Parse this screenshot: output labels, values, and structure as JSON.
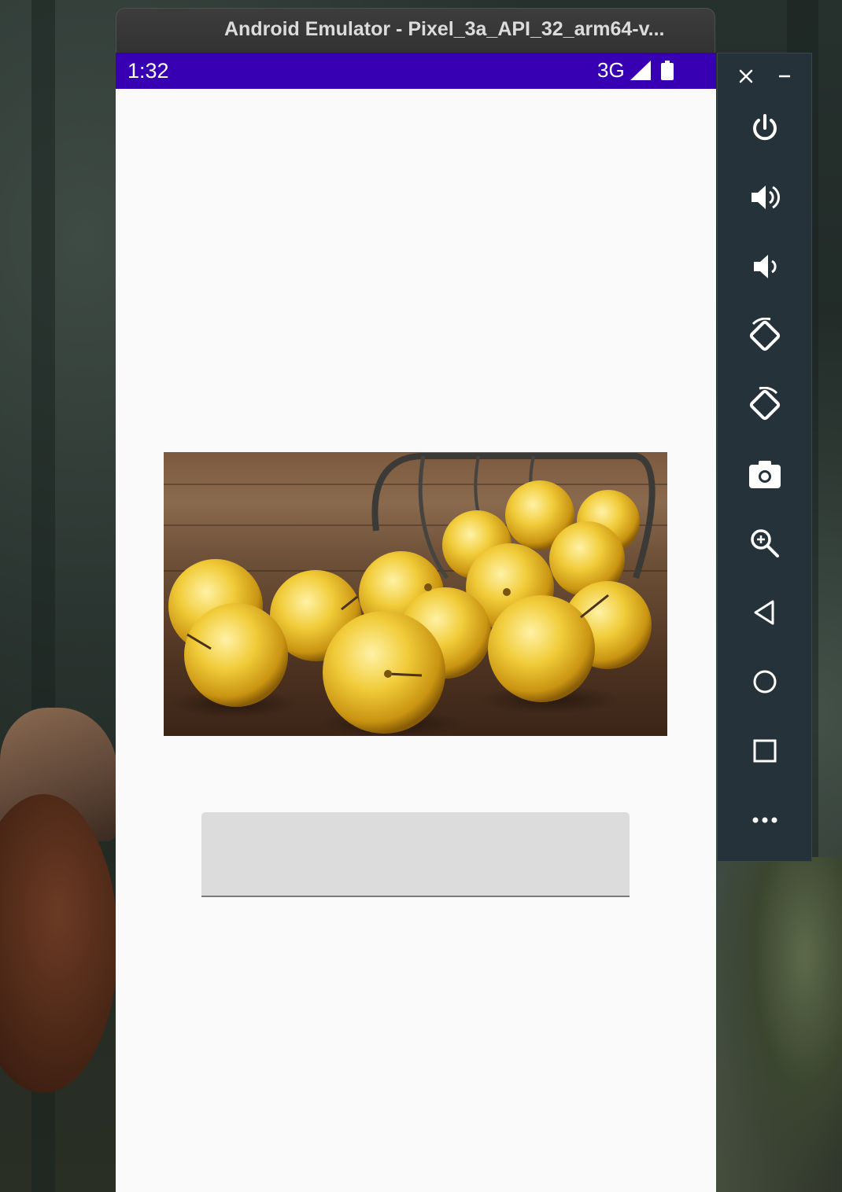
{
  "window": {
    "title": "Android Emulator - Pixel_3a_API_32_arm64-v..."
  },
  "status_bar": {
    "time": "1:32",
    "network": "3G",
    "signal_icon": "signal-icon",
    "battery_icon": "battery-icon",
    "color": "#3700b3"
  },
  "content": {
    "image_description_icon": "yellow-apples-photo",
    "text_field": {
      "value": "",
      "background": "#dcdcdc"
    }
  },
  "toolbar": {
    "buttons": [
      {
        "name": "close",
        "icon": "close-icon"
      },
      {
        "name": "minimize",
        "icon": "minimize-icon"
      },
      {
        "name": "power",
        "icon": "power-icon"
      },
      {
        "name": "volume-up",
        "icon": "volume-up-icon"
      },
      {
        "name": "volume-down",
        "icon": "volume-down-icon"
      },
      {
        "name": "rotate-left",
        "icon": "rotate-left-icon"
      },
      {
        "name": "rotate-right",
        "icon": "rotate-right-icon"
      },
      {
        "name": "screenshot",
        "icon": "camera-icon"
      },
      {
        "name": "zoom",
        "icon": "zoom-icon"
      },
      {
        "name": "back",
        "icon": "back-icon"
      },
      {
        "name": "home",
        "icon": "home-icon"
      },
      {
        "name": "overview",
        "icon": "overview-icon"
      },
      {
        "name": "more",
        "icon": "more-icon"
      }
    ]
  }
}
